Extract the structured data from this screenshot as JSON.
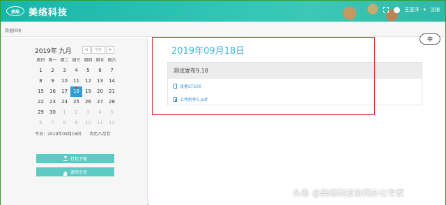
{
  "header": {
    "logo_mark": "美络",
    "app_title": "美络科技",
    "user_name": "王亚洋",
    "user_caret": "▾",
    "logout": "注销"
  },
  "breadcrumb": "数据回收",
  "calendar": {
    "title": "2019年 九月",
    "prev": "<",
    "today_btn": "今天",
    "next": ">",
    "weekdays": [
      "周日",
      "周一",
      "周二",
      "周三",
      "周四",
      "周五",
      "周六"
    ],
    "rows": [
      [
        "1",
        "2",
        "3",
        "4",
        "5",
        "6",
        "7"
      ],
      [
        "8",
        "9",
        "10",
        "11",
        "12",
        "13",
        "14"
      ],
      [
        "15",
        "16",
        "17",
        "18",
        "19",
        "20",
        "21"
      ],
      [
        "22",
        "23",
        "24",
        "25",
        "26",
        "27",
        "28"
      ],
      [
        "29",
        "30",
        "1",
        "2",
        "3",
        "4",
        "5"
      ],
      [
        "6",
        "7",
        "8",
        "9",
        "10",
        "11",
        "12"
      ]
    ],
    "today_line": "今日：2019年09月18日　　农历八月廿"
  },
  "buttons": {
    "download": "打包下载",
    "home": "返回主页"
  },
  "content": {
    "date_title": "2019年09月18日",
    "post_title": "测试发布9.18",
    "attachments": [
      "设备ST500",
      "上传附件1.pdf"
    ]
  },
  "ime_indicator": "中",
  "watermark": "头条 @美络科技协同办公专家",
  "colors": {
    "header": "#2fbfae",
    "accent_blue": "#3bb6d8",
    "button": "#5ccbc4",
    "highlight_box": "#e02020"
  }
}
